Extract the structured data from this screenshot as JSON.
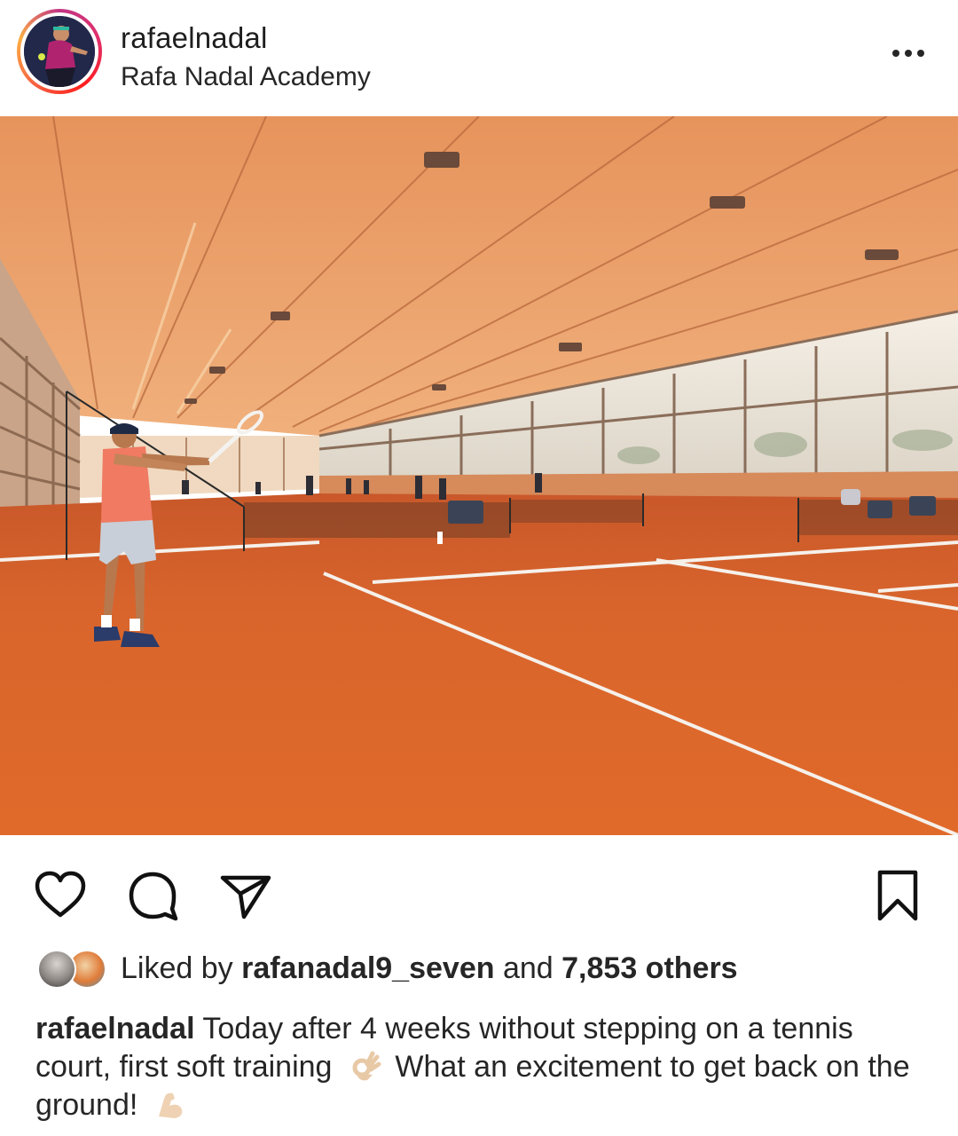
{
  "header": {
    "username": "rafaelnadal",
    "location": "Rafa Nadal Academy",
    "more_icon": "more-horizontal-icon"
  },
  "actions": {
    "like_icon": "heart-icon",
    "comment_icon": "comment-icon",
    "share_icon": "paper-plane-icon",
    "save_icon": "bookmark-icon"
  },
  "likes": {
    "prefix": "Liked by",
    "liker": "rafanadal9_seven",
    "connector": "and",
    "others": "7,853 others"
  },
  "caption": {
    "username": "rafaelnadal",
    "text_1": "Today after 4 weeks without stepping on a tennis court, first soft training",
    "emoji_1": "ok-hand-emoji",
    "text_2": "What an excitement to get back on the ground!",
    "emoji_2": "flexed-biceps-emoji"
  },
  "colors": {
    "clay": "#d9632a",
    "ceiling": "#e8a070",
    "text": "#262626",
    "story_ring": "#e1306c"
  }
}
